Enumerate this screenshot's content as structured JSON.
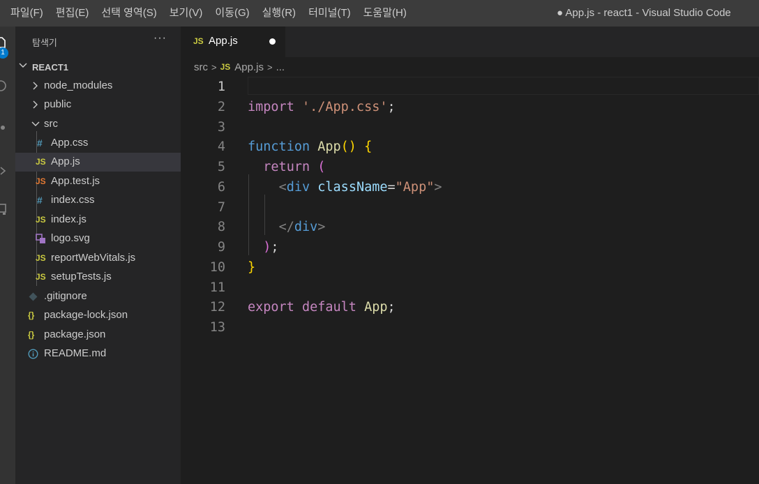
{
  "menu": [
    "파일(F)",
    "편집(E)",
    "선택 영역(S)",
    "보기(V)",
    "이동(G)",
    "실행(R)",
    "터미널(T)",
    "도움말(H)"
  ],
  "window_title": "● App.js - react1 - Visual Studio Code",
  "activity": {
    "badge": "1"
  },
  "sidebar": {
    "title": "탐색기",
    "more": "···",
    "root": "REACT1",
    "items": [
      {
        "label": "node_modules",
        "icon": "chevron-right"
      },
      {
        "label": "public",
        "icon": "chevron-right"
      },
      {
        "label": "src",
        "icon": "chevron-down"
      },
      {
        "label": "App.css",
        "icon": "#"
      },
      {
        "label": "App.js",
        "icon": "JS"
      },
      {
        "label": "App.test.js",
        "icon": "JS"
      },
      {
        "label": "index.css",
        "icon": "#"
      },
      {
        "label": "index.js",
        "icon": "JS"
      },
      {
        "label": "logo.svg",
        "icon": "svg"
      },
      {
        "label": "reportWebVitals.js",
        "icon": "JS"
      },
      {
        "label": "setupTests.js",
        "icon": "JS"
      },
      {
        "label": ".gitignore",
        "icon": "git"
      },
      {
        "label": "package-lock.json",
        "icon": "{}"
      },
      {
        "label": "package.json",
        "icon": "{}"
      },
      {
        "label": "README.md",
        "icon": "info"
      }
    ]
  },
  "tab": {
    "icon": "JS",
    "label": "App.js"
  },
  "breadcrumb": {
    "folder": "src",
    "file_icon": "JS",
    "file": "App.js",
    "more": "..."
  },
  "code": {
    "line_numbers": [
      "1",
      "2",
      "3",
      "4",
      "5",
      "6",
      "7",
      "8",
      "9",
      "10",
      "11",
      "12",
      "13"
    ],
    "t_import": "import",
    "t_import_path": "'./App.css'",
    "t_semicolon": ";",
    "t_function": "function",
    "t_app": "App",
    "t_parens": "()",
    "t_open_brace": "{",
    "t_return": "return",
    "t_open_paren": "(",
    "t_lt": "<",
    "t_div": "div",
    "t_classname": "className",
    "t_eq": "=",
    "t_app_str": "\"App\"",
    "t_gt": ">",
    "t_close_lt": "</",
    "t_close_paren": ")",
    "t_close_brace": "}",
    "t_export": "export",
    "t_default": "default"
  }
}
